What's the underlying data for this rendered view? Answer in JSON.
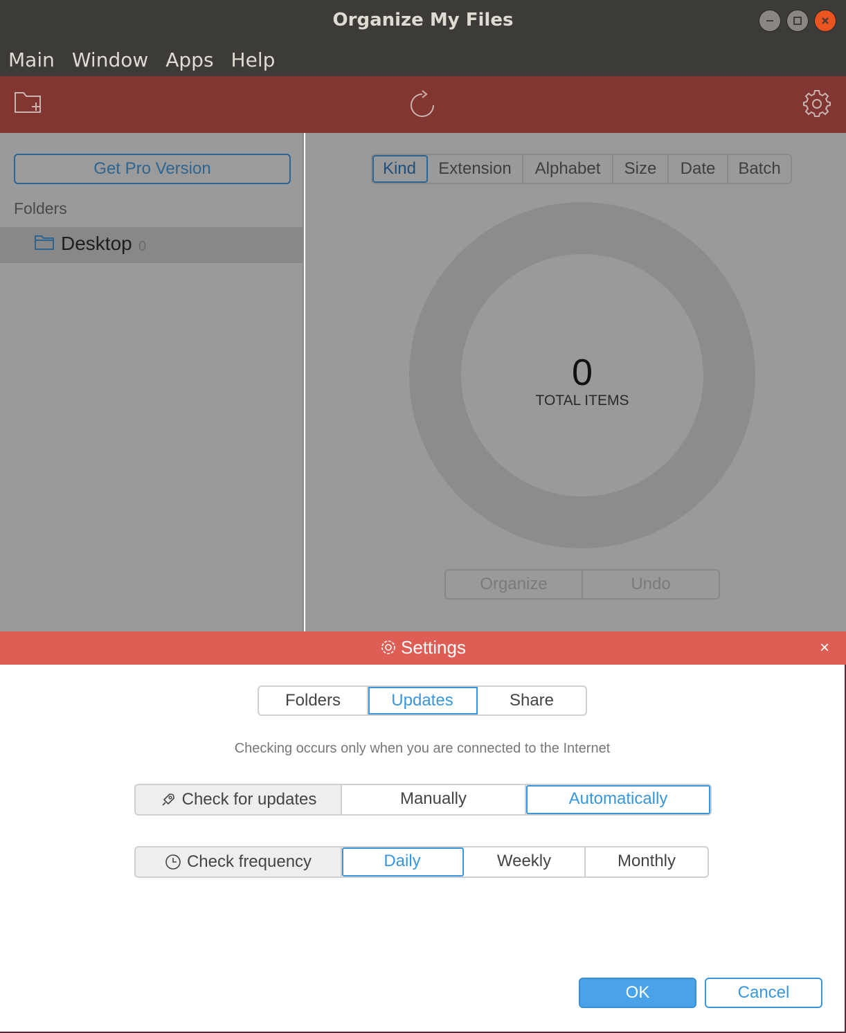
{
  "window": {
    "title": "Organize My Files"
  },
  "menu": [
    "Main",
    "Window",
    "Apps",
    "Help"
  ],
  "toolbar": {
    "add_folder_icon": "folder-plus-icon",
    "refresh_icon": "refresh-icon",
    "settings_icon": "gear-icon"
  },
  "sidebar": {
    "pro_button": "Get Pro Version",
    "folders_label": "Folders",
    "folders": [
      {
        "name": "Desktop",
        "count": "0"
      }
    ]
  },
  "main": {
    "tabs": [
      "Kind",
      "Extension",
      "Alphabet",
      "Size",
      "Date",
      "Batch"
    ],
    "active_tab": "Kind",
    "total_count": "0",
    "total_label": "TOTAL ITEMS",
    "organize_label": "Organize",
    "undo_label": "Undo"
  },
  "settings": {
    "title": "Settings",
    "close": "×",
    "tabs": [
      "Folders",
      "Updates",
      "Share"
    ],
    "active_tab": "Updates",
    "hint": "Checking occurs only when you are connected to the Internet",
    "check_updates": {
      "label": "Check for updates",
      "options": [
        "Manually",
        "Automatically"
      ],
      "selected": "Automatically"
    },
    "check_frequency": {
      "label": "Check frequency",
      "options": [
        "Daily",
        "Weekly",
        "Monthly"
      ],
      "selected": "Daily"
    },
    "ok_label": "OK",
    "cancel_label": "Cancel"
  },
  "colors": {
    "toolbar": "#823631",
    "dialog_header": "#de5d55",
    "accent": "#3a96dc",
    "titlebar": "#3c3b37"
  }
}
